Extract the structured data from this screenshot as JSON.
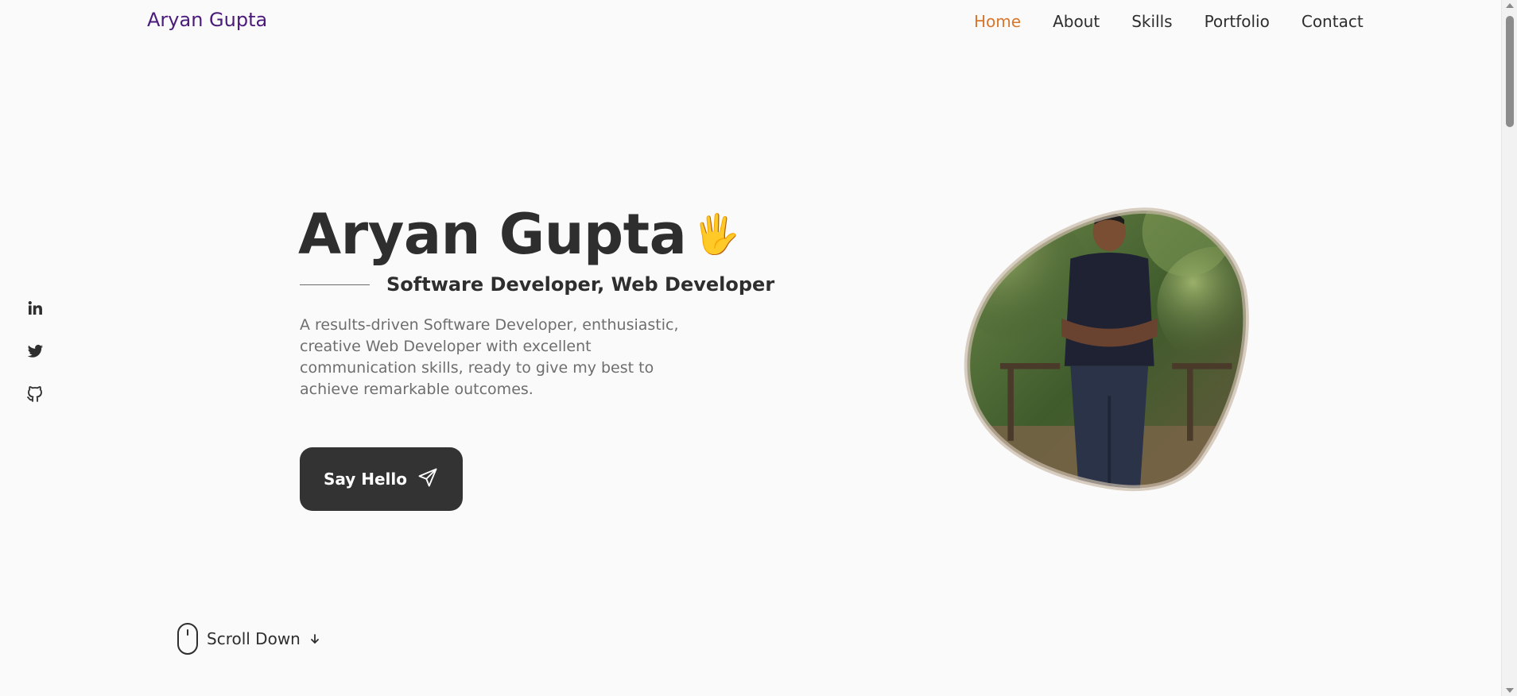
{
  "header": {
    "brand": "Aryan Gupta",
    "nav": [
      {
        "label": "Home",
        "active": true
      },
      {
        "label": "About",
        "active": false
      },
      {
        "label": "Skills",
        "active": false
      },
      {
        "label": "Portfolio",
        "active": false
      },
      {
        "label": "Contact",
        "active": false
      }
    ]
  },
  "social": [
    {
      "icon": "linkedin-icon"
    },
    {
      "icon": "twitter-icon"
    },
    {
      "icon": "github-icon"
    }
  ],
  "hero": {
    "title": "Aryan Gupta",
    "wave": "🖐",
    "subtitle": "Software Developer, Web Developer",
    "description": "A results-driven Software Developer, enthusiastic, creative Web Developer with excellent communication skills, ready to give my best to achieve remarkable outcomes.",
    "button_label": "Say Hello",
    "button_icon": "send-icon",
    "image": "profile-photo"
  },
  "scroll": {
    "label": "Scroll Down",
    "icon": "mouse-icon",
    "arrow_icon": "arrow-down-icon"
  },
  "colors": {
    "brand": "#4b1b7a",
    "accent": "#d8762b",
    "text": "#2e2e2e",
    "button_bg": "#333333",
    "background": "#fafafa"
  }
}
